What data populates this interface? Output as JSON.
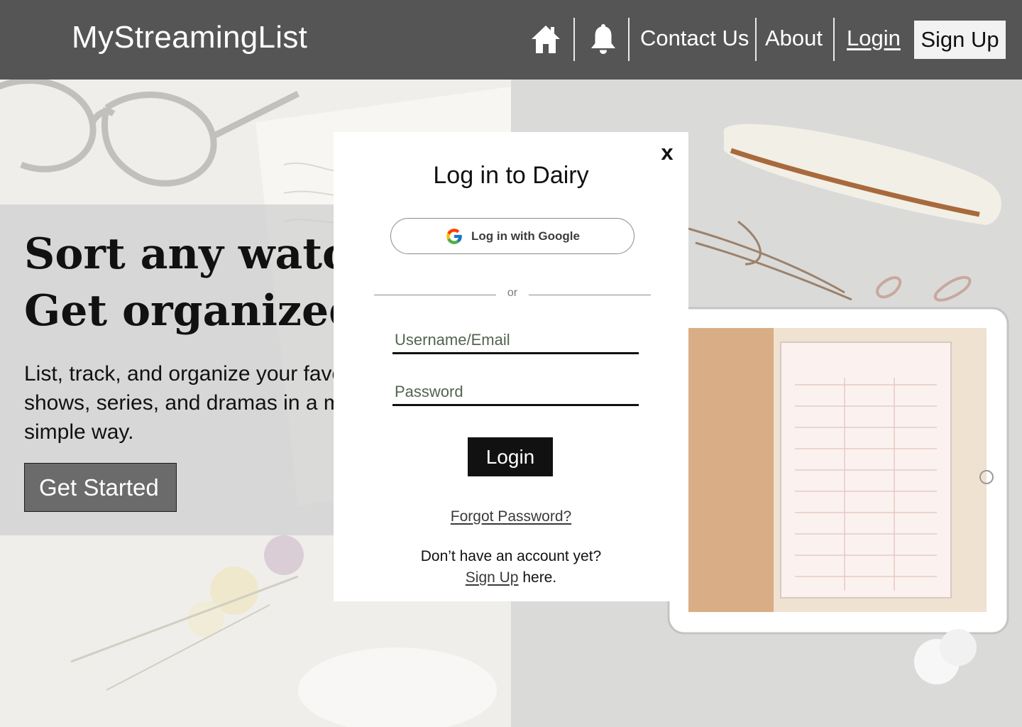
{
  "colors": {
    "navbar": "#555555",
    "primary_button": "#111111",
    "secondary_button": "#6b6b6b",
    "modal": "#ffffff"
  },
  "navbar": {
    "brand": "MyStreamingList",
    "home_icon": "home-icon",
    "notification_icon": "bell-icon",
    "links": {
      "contact": "Contact Us",
      "about": "About",
      "login": "Login",
      "signup": "Sign Up"
    }
  },
  "hero": {
    "title_line1": "Sort any watching.",
    "title_line2": "Get organized.",
    "subtitle": "List, track, and organize your favorite film, TV shows, series, and dramas in a more structured and simple way.",
    "cta": "Get Started"
  },
  "modal": {
    "close": "x",
    "title": "Log in to Dairy",
    "google_button": "Log in with Google",
    "google_icon": "google-icon",
    "divider_text": "or",
    "username_placeholder": "Username/Email",
    "password_placeholder": "Password",
    "login_button": "Login",
    "forgot_password": "Forgot Password?",
    "no_account": "Don’t have an account yet?",
    "signup_link": "Sign Up",
    "signup_suffix": " here."
  }
}
